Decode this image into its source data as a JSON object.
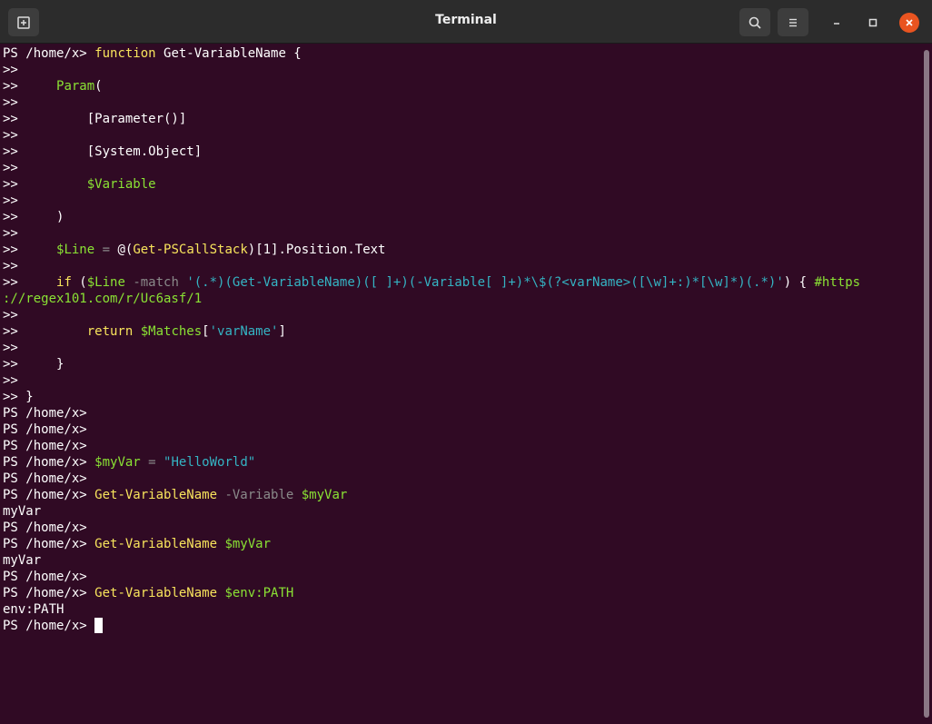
{
  "window": {
    "title": "Terminal",
    "new_tab_label": "new-tab",
    "search_label": "search",
    "menu_label": "menu"
  },
  "terminal": {
    "lines": [
      [
        {
          "t": "PS /home/x> ",
          "c": "plain"
        },
        {
          "t": "function",
          "c": "kw"
        },
        {
          "t": " Get-VariableName {",
          "c": "plain"
        }
      ],
      [
        {
          "t": ">>",
          "c": "plain"
        }
      ],
      [
        {
          "t": ">>     ",
          "c": "plain"
        },
        {
          "t": "Param",
          "c": "var"
        },
        {
          "t": "(",
          "c": "plain"
        }
      ],
      [
        {
          "t": ">>",
          "c": "plain"
        }
      ],
      [
        {
          "t": ">>         [Parameter()]",
          "c": "plain"
        }
      ],
      [
        {
          "t": ">>",
          "c": "plain"
        }
      ],
      [
        {
          "t": ">>         [System.Object]",
          "c": "plain"
        }
      ],
      [
        {
          "t": ">>",
          "c": "plain"
        }
      ],
      [
        {
          "t": ">>         ",
          "c": "plain"
        },
        {
          "t": "$Variable",
          "c": "var"
        }
      ],
      [
        {
          "t": ">>",
          "c": "plain"
        }
      ],
      [
        {
          "t": ">>     )",
          "c": "plain"
        }
      ],
      [
        {
          "t": ">>",
          "c": "plain"
        }
      ],
      [
        {
          "t": ">>     ",
          "c": "plain"
        },
        {
          "t": "$Line",
          "c": "var"
        },
        {
          "t": " = ",
          "c": "op"
        },
        {
          "t": "@(",
          "c": "plain"
        },
        {
          "t": "Get-PSCallStack",
          "c": "cmd"
        },
        {
          "t": ")[1].Position.Text",
          "c": "plain"
        }
      ],
      [
        {
          "t": ">>",
          "c": "plain"
        }
      ],
      [
        {
          "t": ">>     ",
          "c": "plain"
        },
        {
          "t": "if",
          "c": "kw"
        },
        {
          "t": " (",
          "c": "plain"
        },
        {
          "t": "$Line",
          "c": "var"
        },
        {
          "t": " -match ",
          "c": "param"
        },
        {
          "t": "'(.*)(Get-VariableName)([ ]+)(-Variable[ ]+)*\\$(?<varName>([\\w]+:)*[\\w]*)(.*)'",
          "c": "str"
        },
        {
          "t": ") { ",
          "c": "plain"
        },
        {
          "t": "#https",
          "c": "cmt"
        }
      ],
      [
        {
          "t": "://regex101.com/r/Uc6asf/1",
          "c": "cmt"
        }
      ],
      [
        {
          "t": ">>",
          "c": "plain"
        }
      ],
      [
        {
          "t": ">>         ",
          "c": "plain"
        },
        {
          "t": "return",
          "c": "kw"
        },
        {
          "t": " ",
          "c": "plain"
        },
        {
          "t": "$Matches",
          "c": "var"
        },
        {
          "t": "[",
          "c": "plain"
        },
        {
          "t": "'varName'",
          "c": "str"
        },
        {
          "t": "]",
          "c": "plain"
        }
      ],
      [
        {
          "t": ">>",
          "c": "plain"
        }
      ],
      [
        {
          "t": ">>     }",
          "c": "plain"
        }
      ],
      [
        {
          "t": ">>",
          "c": "plain"
        }
      ],
      [
        {
          "t": ">> }",
          "c": "plain"
        }
      ],
      [
        {
          "t": "PS /home/x>",
          "c": "plain"
        }
      ],
      [
        {
          "t": "PS /home/x>",
          "c": "plain"
        }
      ],
      [
        {
          "t": "PS /home/x>",
          "c": "plain"
        }
      ],
      [
        {
          "t": "PS /home/x> ",
          "c": "plain"
        },
        {
          "t": "$myVar",
          "c": "var"
        },
        {
          "t": " = ",
          "c": "op"
        },
        {
          "t": "\"HelloWorld\"",
          "c": "str"
        }
      ],
      [
        {
          "t": "PS /home/x>",
          "c": "plain"
        }
      ],
      [
        {
          "t": "PS /home/x> ",
          "c": "plain"
        },
        {
          "t": "Get-VariableName",
          "c": "cmd"
        },
        {
          "t": " -Variable ",
          "c": "param"
        },
        {
          "t": "$myVar",
          "c": "var"
        }
      ],
      [
        {
          "t": "myVar",
          "c": "plain"
        }
      ],
      [
        {
          "t": "PS /home/x>",
          "c": "plain"
        }
      ],
      [
        {
          "t": "PS /home/x> ",
          "c": "plain"
        },
        {
          "t": "Get-VariableName",
          "c": "cmd"
        },
        {
          "t": " ",
          "c": "plain"
        },
        {
          "t": "$myVar",
          "c": "var"
        }
      ],
      [
        {
          "t": "myVar",
          "c": "plain"
        }
      ],
      [
        {
          "t": "PS /home/x>",
          "c": "plain"
        }
      ],
      [
        {
          "t": "PS /home/x> ",
          "c": "plain"
        },
        {
          "t": "Get-VariableName",
          "c": "cmd"
        },
        {
          "t": " ",
          "c": "plain"
        },
        {
          "t": "$env:PATH",
          "c": "var"
        }
      ],
      [
        {
          "t": "env:PATH",
          "c": "plain"
        }
      ],
      [
        {
          "t": "PS /home/x> ",
          "c": "plain"
        }
      ]
    ]
  },
  "colors": {
    "background": "#300a24",
    "titlebar": "#2c2c2c",
    "close": "#e95420",
    "yellow": "#f8e45c",
    "green": "#8ae234",
    "cyan": "#34b4c4",
    "gray": "#8a8a8a"
  },
  "icons": {
    "new_tab": "new-tab-icon",
    "search": "search-icon",
    "menu": "hamburger-menu-icon",
    "minimize": "minimize-icon",
    "maximize": "maximize-icon",
    "close": "close-icon"
  }
}
